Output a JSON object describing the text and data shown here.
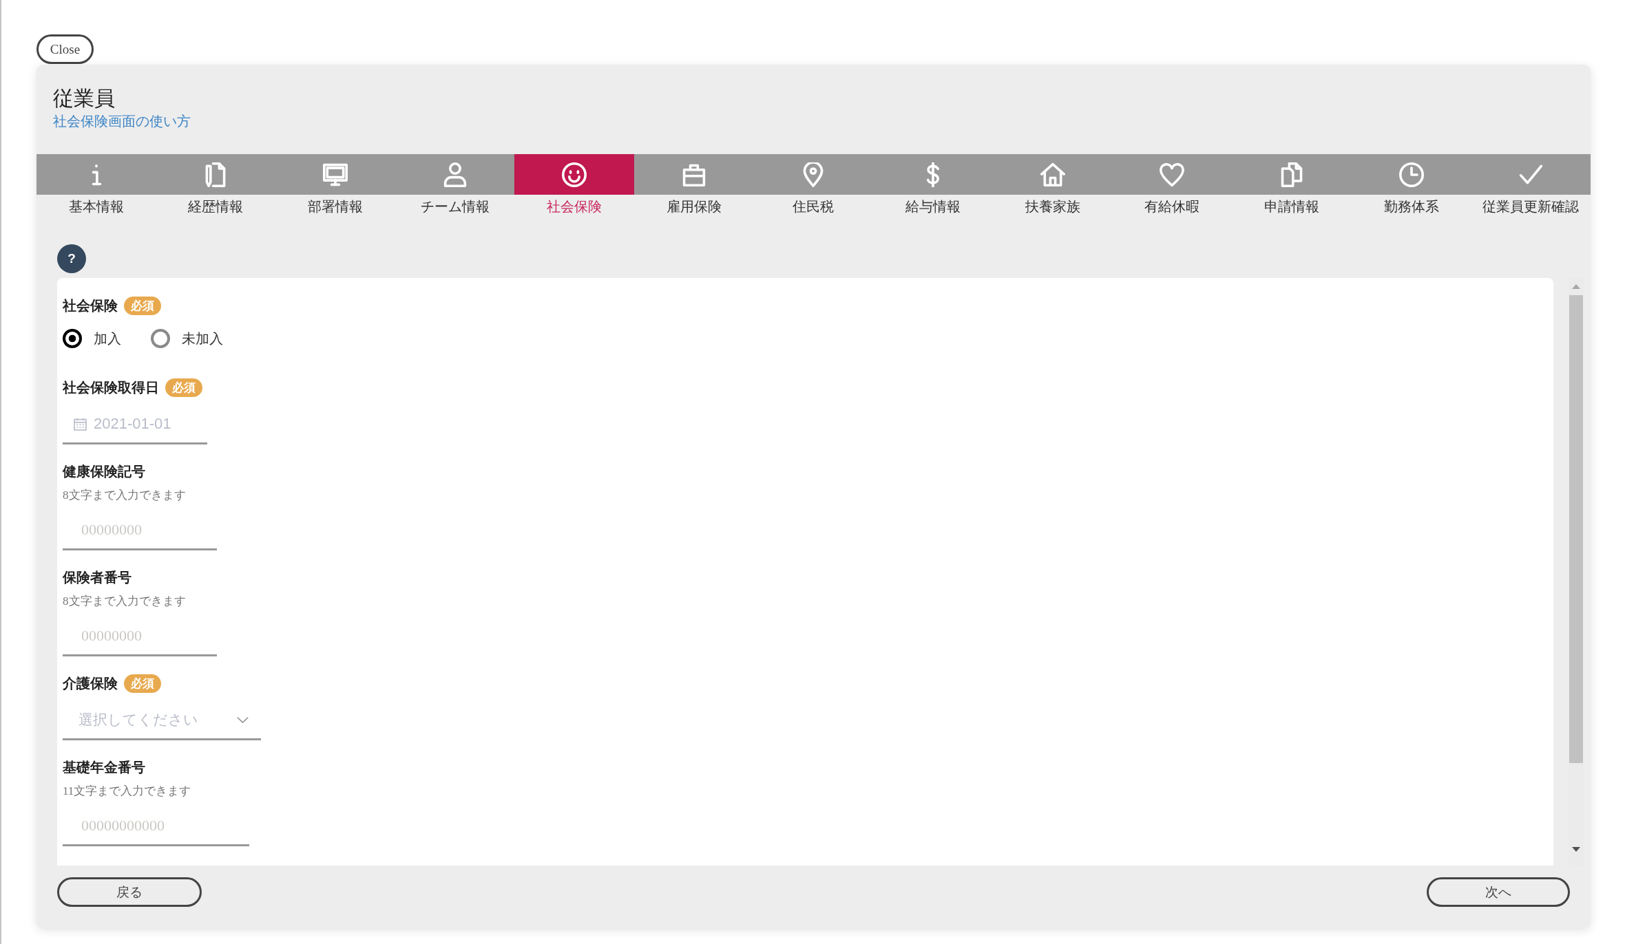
{
  "close_button": {
    "label": "Close"
  },
  "header": {
    "title": "従業員",
    "help_link": "社会保険画面の使い方"
  },
  "tabs": [
    {
      "label": "基本情報",
      "selected": false
    },
    {
      "label": "経歴情報",
      "selected": false
    },
    {
      "label": "部署情報",
      "selected": false
    },
    {
      "label": "チーム情報",
      "selected": false
    },
    {
      "label": "社会保険",
      "selected": true
    },
    {
      "label": "雇用保険",
      "selected": false
    },
    {
      "label": "住民税",
      "selected": false
    },
    {
      "label": "給与情報",
      "selected": false
    },
    {
      "label": "扶養家族",
      "selected": false
    },
    {
      "label": "有給休暇",
      "selected": false
    },
    {
      "label": "申請情報",
      "selected": false
    },
    {
      "label": "勤務体系",
      "selected": false
    },
    {
      "label": "従業員更新確認",
      "selected": false
    }
  ],
  "help_button": {
    "label": "?"
  },
  "form": {
    "fields": [
      {
        "kind": "radio",
        "label": "社会保険",
        "badge": "必須",
        "options": [
          {
            "label": "加入",
            "selected": true
          },
          {
            "label": "未加入",
            "selected": false
          }
        ]
      },
      {
        "kind": "date",
        "label": "社会保険取得日",
        "badge": "必須",
        "placeholder": "2021-01-01"
      },
      {
        "kind": "text",
        "label": "健康保険記号",
        "hint": "8文字まで入力できます",
        "placeholder": "00000000"
      },
      {
        "kind": "text",
        "label": "保険者番号",
        "hint": "8文字まで入力できます",
        "placeholder": "00000000"
      },
      {
        "kind": "select",
        "label": "介護保険",
        "badge": "必須",
        "placeholder": "選択してください"
      },
      {
        "kind": "text",
        "label": "基礎年金番号",
        "hint": "11文字まで入力できます",
        "placeholder": "00000000000"
      }
    ]
  },
  "footer": {
    "back_button": "戻る",
    "next_button": "次へ"
  }
}
